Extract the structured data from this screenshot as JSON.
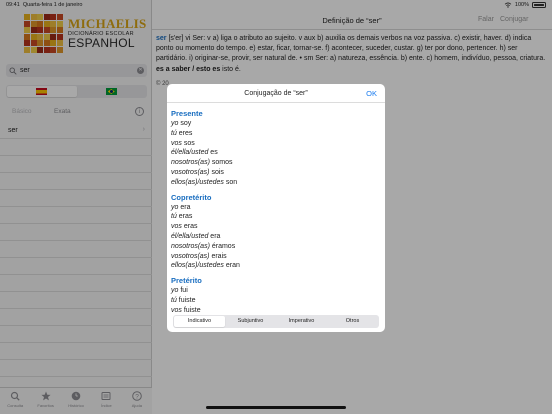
{
  "status": {
    "time": "09:41",
    "date": "Quarta-feira 1 de janeiro",
    "battery": "100%"
  },
  "logo": {
    "brand": "MICHAELIS",
    "sub": "DICIONÁRIO ESCOLAR",
    "lang": "ESPANHOL"
  },
  "search": {
    "value": "ser",
    "clear": "✕"
  },
  "modes": {
    "basic": "Básico",
    "exact": "Exata",
    "info": "i"
  },
  "results": [
    {
      "label": "ser",
      "chevron": "›"
    },
    "",
    "",
    "",
    "",
    "",
    "",
    "",
    "",
    "",
    "",
    "",
    "",
    "",
    "",
    ""
  ],
  "tabs": [
    {
      "label": "Consulta",
      "icon": "search-icon"
    },
    {
      "label": "Favoritos",
      "icon": "star-icon"
    },
    {
      "label": "Histórico",
      "icon": "clock-icon"
    },
    {
      "label": "Índice",
      "icon": "list-icon"
    },
    {
      "label": "Ajuda",
      "icon": "help-icon"
    }
  ],
  "main": {
    "title": "Definição de “ser”",
    "speak": "Falar",
    "conjugate": "Conjugar",
    "definition": {
      "headword": "ser",
      "text": " [s'er] vi Ser: v a) liga o atributo ao sujeito. v aux b) auxilia os demais verbos na voz passiva. c) existir, haver. d) indica ponto ou momento do tempo. e) estar, ficar, tornar-se. f) acontecer, suceder, custar. g) ter por dono, pertencer. h) ser partidário. i) originar-se, provir, ser natural de. • sm Ser: a) natureza, essência. b) ente. c) homem, indivíduo, pessoa, criatura. ",
      "phrase": "es a saber / esto es",
      "phrase_gloss": " isto é."
    },
    "copyright": "© 20"
  },
  "modal": {
    "title": "Conjugação de “ser”",
    "ok": "OK",
    "tenses": [
      {
        "name": "Presente",
        "forms": [
          {
            "pron": "yo",
            "verb": " soy"
          },
          {
            "pron": "tú",
            "verb": " eres"
          },
          {
            "pron": "vos",
            "verb": " sos"
          },
          {
            "pron": "él/ella/usted",
            "verb": " es"
          },
          {
            "pron": "nosotros(as)",
            "verb": " somos"
          },
          {
            "pron": "vosotros(as)",
            "verb": " sois"
          },
          {
            "pron": "ellos(as)/ustedes",
            "verb": " son"
          }
        ]
      },
      {
        "name": "Copretérito",
        "forms": [
          {
            "pron": "yo",
            "verb": " era"
          },
          {
            "pron": "tú",
            "verb": " eras"
          },
          {
            "pron": "vos",
            "verb": " eras"
          },
          {
            "pron": "él/ella/usted",
            "verb": " era"
          },
          {
            "pron": "nosotros(as)",
            "verb": " éramos"
          },
          {
            "pron": "vosotros(as)",
            "verb": " erais"
          },
          {
            "pron": "ellos(as)/ustedes",
            "verb": " eran"
          }
        ]
      },
      {
        "name": "Pretérito",
        "forms": [
          {
            "pron": "yo",
            "verb": " fui"
          },
          {
            "pron": "tú",
            "verb": " fuiste"
          },
          {
            "pron": "vos",
            "verb": " fuiste"
          }
        ]
      }
    ],
    "moods": [
      "Indicativo",
      "Subjuntivo",
      "Imperativo",
      "Otros"
    ],
    "active_mood": "Indicativo"
  },
  "colors": {
    "accent": "#1a7cf0",
    "headword": "#1a6ec0",
    "brand": "#d8a416"
  }
}
